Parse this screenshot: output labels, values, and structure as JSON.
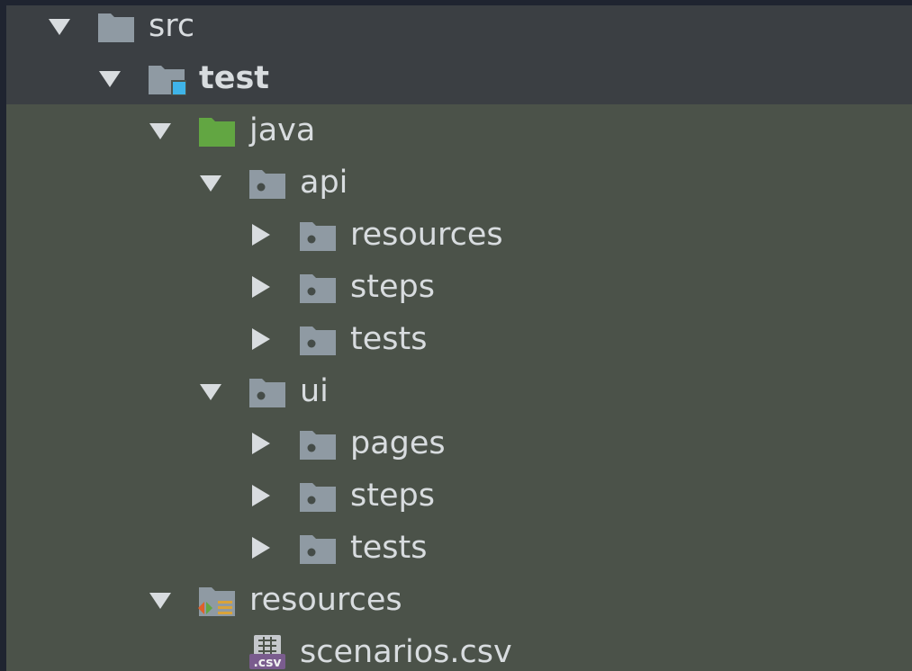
{
  "project_tree": {
    "nodes": [
      {
        "label": "src",
        "expanded": true,
        "icon": "folder-icon",
        "bold": false
      },
      {
        "label": "test",
        "expanded": true,
        "icon": "test-root-folder-icon",
        "bold": true
      },
      {
        "label": "java",
        "expanded": true,
        "icon": "source-folder-icon",
        "bold": false
      },
      {
        "label": "api",
        "expanded": true,
        "icon": "package-icon",
        "bold": false
      },
      {
        "label": "resources",
        "expanded": false,
        "icon": "package-icon",
        "bold": false
      },
      {
        "label": "steps",
        "expanded": false,
        "icon": "package-icon",
        "bold": false
      },
      {
        "label": "tests",
        "expanded": false,
        "icon": "package-icon",
        "bold": false
      },
      {
        "label": "ui",
        "expanded": true,
        "icon": "package-icon",
        "bold": false
      },
      {
        "label": "pages",
        "expanded": false,
        "icon": "package-icon",
        "bold": false
      },
      {
        "label": "steps",
        "expanded": false,
        "icon": "package-icon",
        "bold": false
      },
      {
        "label": "tests",
        "expanded": false,
        "icon": "package-icon",
        "bold": false
      },
      {
        "label": "resources",
        "expanded": true,
        "icon": "test-resources-folder-icon",
        "bold": false
      },
      {
        "label": "scenarios.csv",
        "expanded": null,
        "icon": "csv-file-icon",
        "bold": false
      }
    ]
  },
  "colors": {
    "tree_background": "#4b5249",
    "header_background": "#3b3f43",
    "text": "#d8dcdf",
    "folder": "#8f9aa3",
    "source_folder": "#62a642",
    "test_marker": "#3fb4e8"
  }
}
